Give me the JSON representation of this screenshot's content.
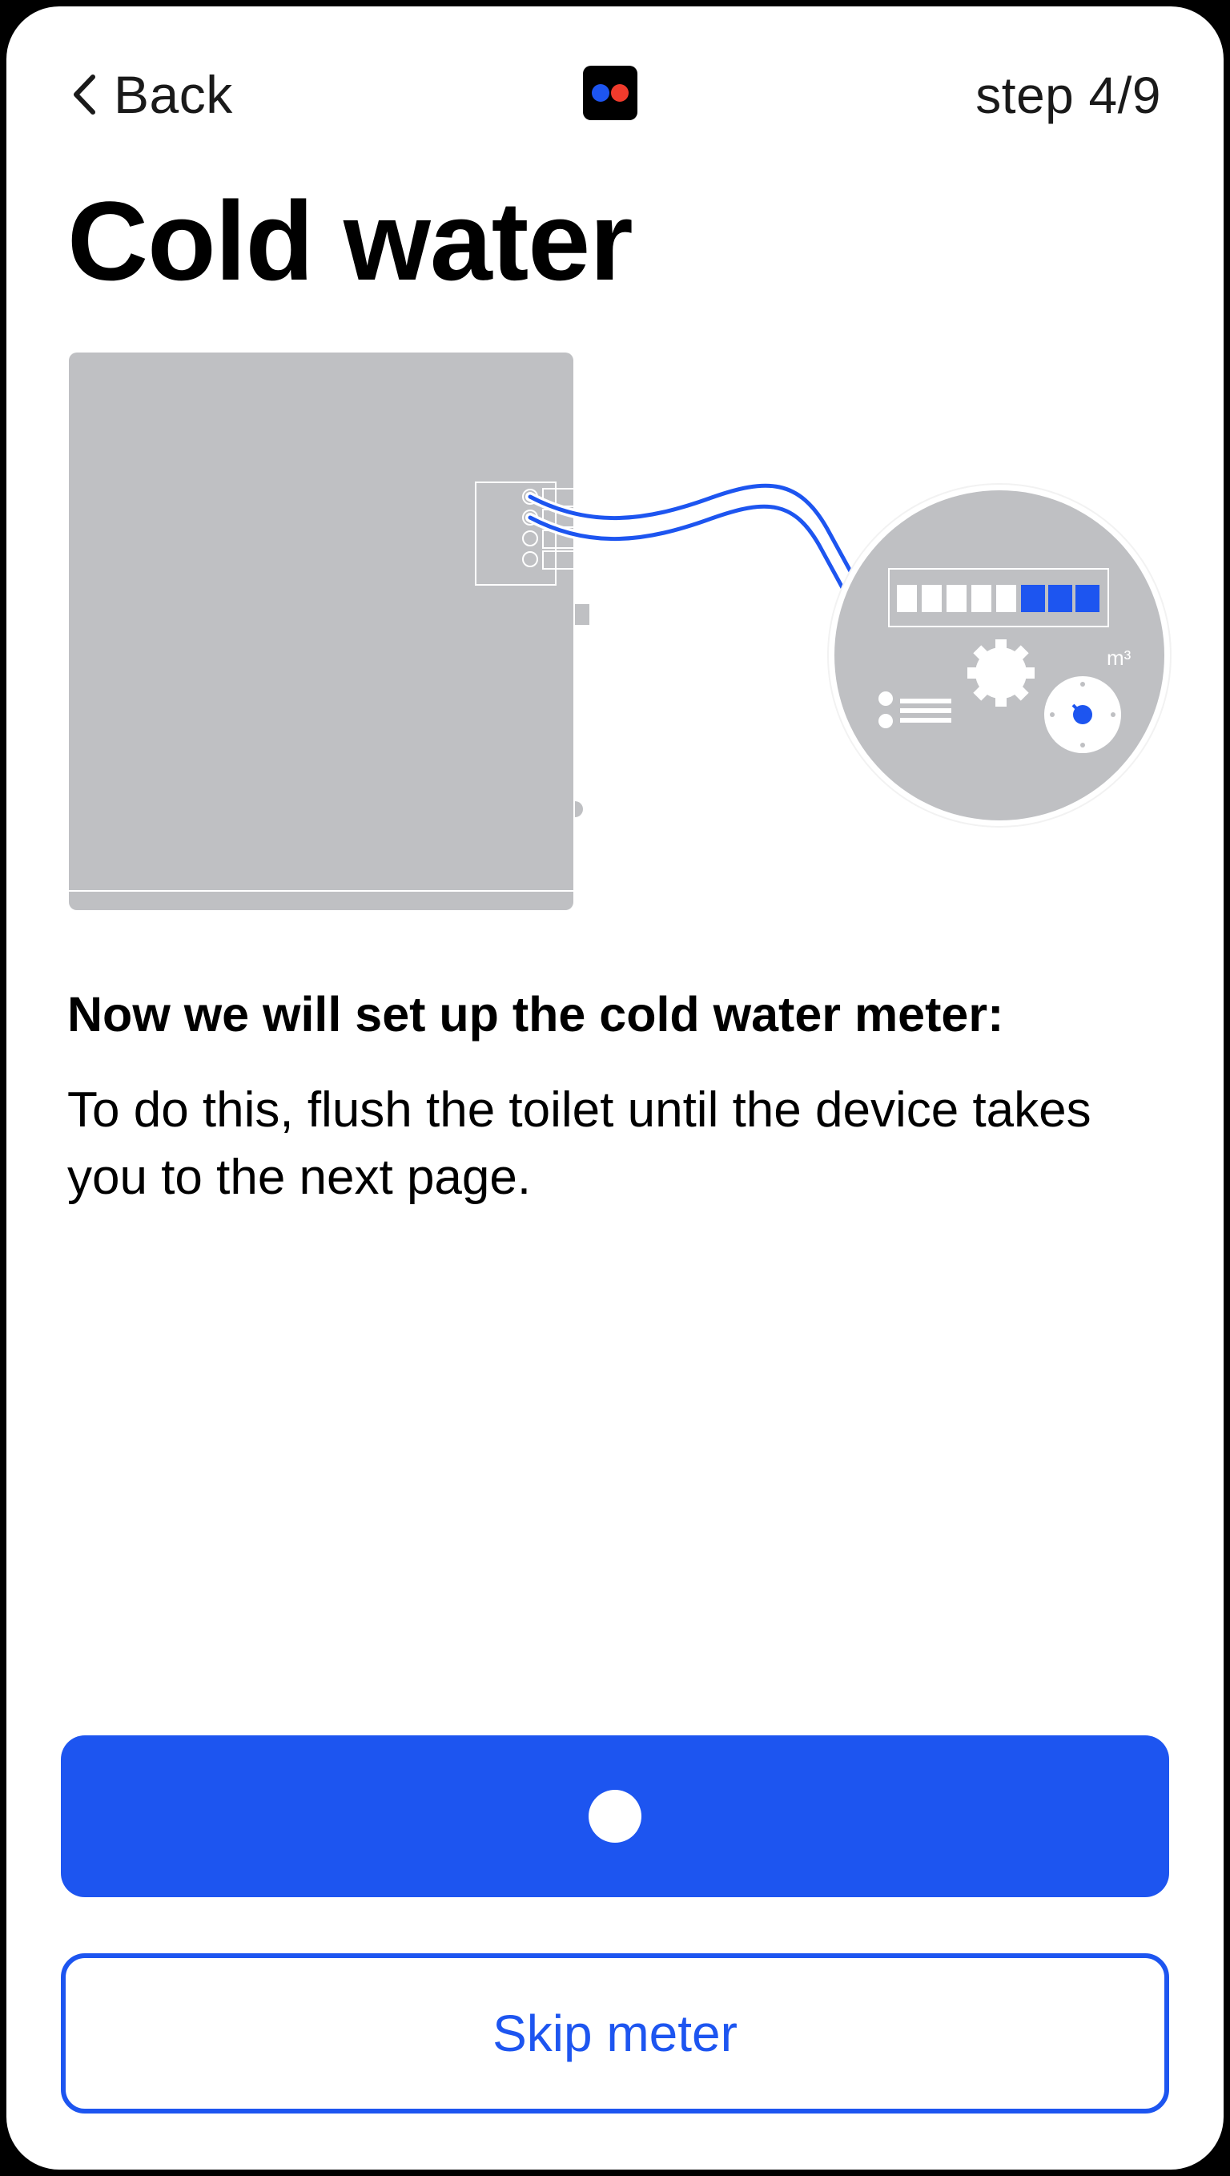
{
  "header": {
    "back_label": "Back",
    "step_label": "step 4/9",
    "logo_icon": "two-dots-logo"
  },
  "page": {
    "title": "Cold water",
    "subheading": "Now we will set up the cold water meter:",
    "instruction": "To do this, flush the toilet until the device takes you to the next page."
  },
  "illustration": {
    "meter_unit": "m³",
    "digit_count": 8,
    "highlighted_digits": 3
  },
  "actions": {
    "primary_state": "loading",
    "skip_label": "Skip meter"
  },
  "colors": {
    "accent": "#1d55f0",
    "logo_red": "#f03b2c",
    "device_gray": "#bfc0c3",
    "text": "#000000"
  }
}
